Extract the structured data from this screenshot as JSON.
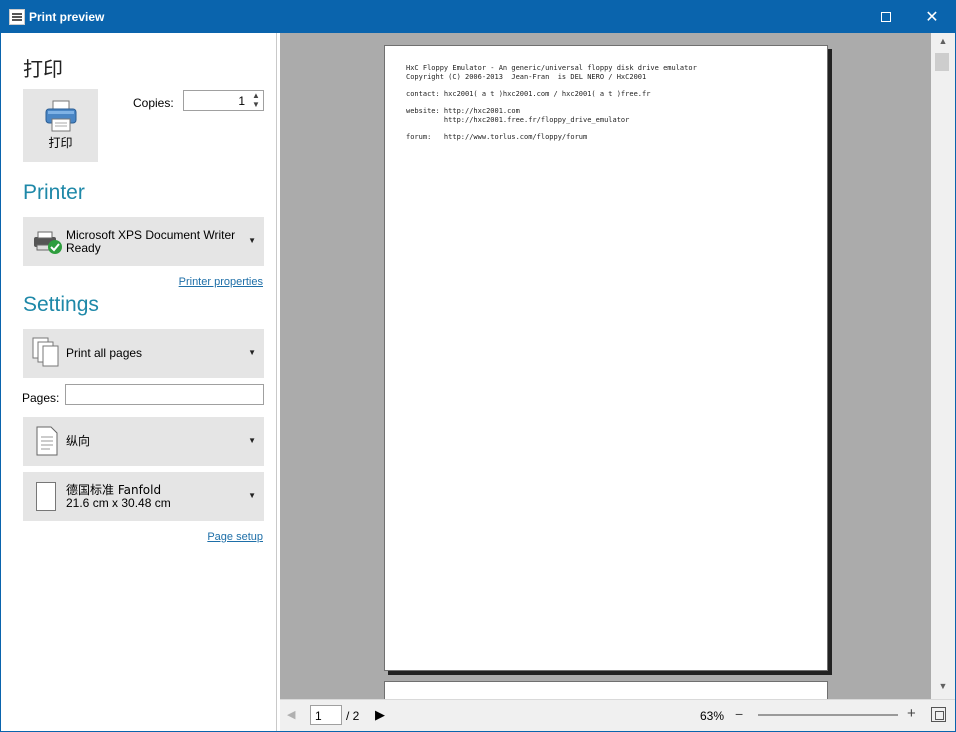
{
  "window": {
    "title": "Print preview",
    "maximize_glyph": "□",
    "close_glyph": "✕"
  },
  "print": {
    "heading": "打印",
    "button_label": "打印",
    "copies_label": "Copies:",
    "copies_value": "1"
  },
  "printer": {
    "heading": "Printer",
    "name": "Microsoft XPS Document Writer",
    "status": "Ready",
    "properties_link": "Printer properties"
  },
  "settings": {
    "heading": "Settings",
    "range": "Print all pages",
    "pages_label": "Pages:",
    "pages_value": "",
    "orientation": "纵向",
    "paper_name": "德国标准 Fanfold",
    "paper_size": "21.6 cm x 30.48 cm",
    "page_setup_link": "Page setup"
  },
  "preview": {
    "lines": [
      "HxC Floppy Emulator - An generic/universal floppy disk drive emulator",
      "Copyright (C) 2006-2013  Jean-Fran  is DEL NERO / HxC2001",
      "",
      "contact: hxc2001( a t )hxc2001.com / hxc2001( a t )free.fr",
      "",
      "website: http://hxc2001.com",
      "         http://hxc2001.free.fr/floppy_drive_emulator",
      "",
      "forum:   http://www.torlus.com/floppy/forum"
    ]
  },
  "navigation": {
    "current_page": "1",
    "total_pages": "/ 2",
    "zoom": "63%",
    "zoom_level_percent": 63
  },
  "icons": [
    "app-icon",
    "printer-icon",
    "printer-check-icon",
    "pages-icon",
    "portrait-page-icon",
    "paper-icon",
    "dropdown-arrow-icon",
    "prev-page-icon",
    "next-page-icon",
    "zoom-out-icon",
    "zoom-in-icon",
    "fit-page-icon",
    "scroll-up-icon",
    "scroll-down-icon"
  ]
}
